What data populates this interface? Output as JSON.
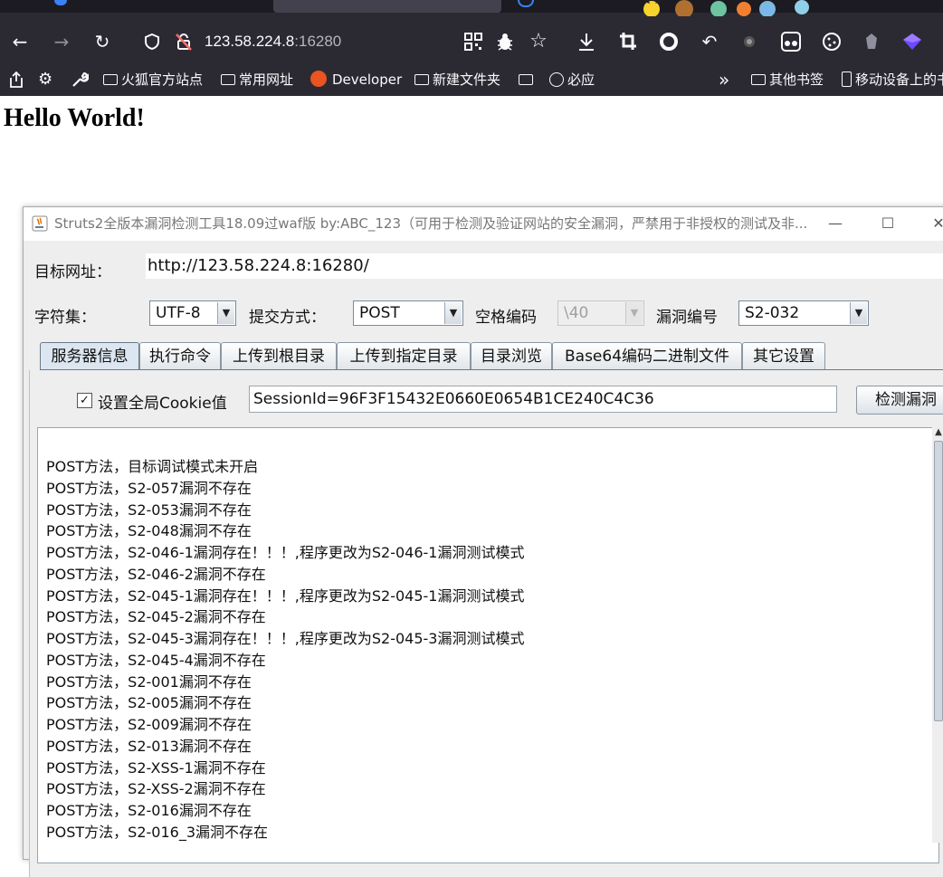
{
  "browser": {
    "address": {
      "host": "123.58.224.8",
      "port": ":16280"
    },
    "bookmarks": [
      {
        "label": "火狐官方站点"
      },
      {
        "label": "常用网址"
      },
      {
        "label": "Developer"
      },
      {
        "label": "新建文件夹"
      },
      {
        "label": "必应"
      },
      {
        "label": "其他书签"
      },
      {
        "label": "移动设备上的书签"
      }
    ],
    "overflow_label": "»"
  },
  "page": {
    "heading": "Hello World!"
  },
  "app": {
    "title": "Struts2全版本漏洞检测工具18.09过waf版 by:ABC_123（可用于检测及验证网站的安全漏洞，严禁用于非授权的测试及非...",
    "window_buttons": {
      "minimize": "—",
      "maximize": "☐",
      "close": "✕"
    },
    "target_label": "目标网址：",
    "target_url": "http://123.58.224.8:16280/",
    "charset_label": "字符集：",
    "charset_value": "UTF-8",
    "method_label": "提交方式：",
    "method_value": "POST",
    "space_label": "空格编码",
    "space_value": "\\40",
    "vuln_label": "漏洞编号",
    "vuln_value": "S2-032",
    "tabs": [
      {
        "label": "服务器信息"
      },
      {
        "label": "执行命令"
      },
      {
        "label": "上传到根目录"
      },
      {
        "label": "上传到指定目录"
      },
      {
        "label": "目录浏览"
      },
      {
        "label": "Base64编码二进制文件"
      },
      {
        "label": "其它设置"
      }
    ],
    "cookie_checkbox_label": "设置全局Cookie值",
    "cookie_checked": true,
    "cookie_value": "SessionId=96F3F15432E0660E0654B1CE240C4C36",
    "detect_button": "检测漏洞",
    "log_lines": [
      "POST方法，目标调试模式未开启",
      "POST方法，S2-057漏洞不存在",
      "POST方法，S2-053漏洞不存在",
      "POST方法，S2-048漏洞不存在",
      "POST方法，S2-046-1漏洞存在！！！,程序更改为S2-046-1漏洞测试模式",
      "POST方法，S2-046-2漏洞不存在",
      "POST方法，S2-045-1漏洞存在！！！,程序更改为S2-045-1漏洞测试模式",
      "POST方法，S2-045-2漏洞不存在",
      "POST方法，S2-045-3漏洞存在！！！,程序更改为S2-045-3漏洞测试模式",
      "POST方法，S2-045-4漏洞不存在",
      "POST方法，S2-001漏洞不存在",
      "POST方法，S2-005漏洞不存在",
      "POST方法，S2-009漏洞不存在",
      "POST方法，S2-013漏洞不存在",
      "POST方法，S2-XSS-1漏洞不存在",
      "POST方法，S2-XSS-2漏洞不存在",
      "POST方法，S2-016漏洞不存在",
      "POST方法，S2-016_3漏洞不存在"
    ]
  }
}
